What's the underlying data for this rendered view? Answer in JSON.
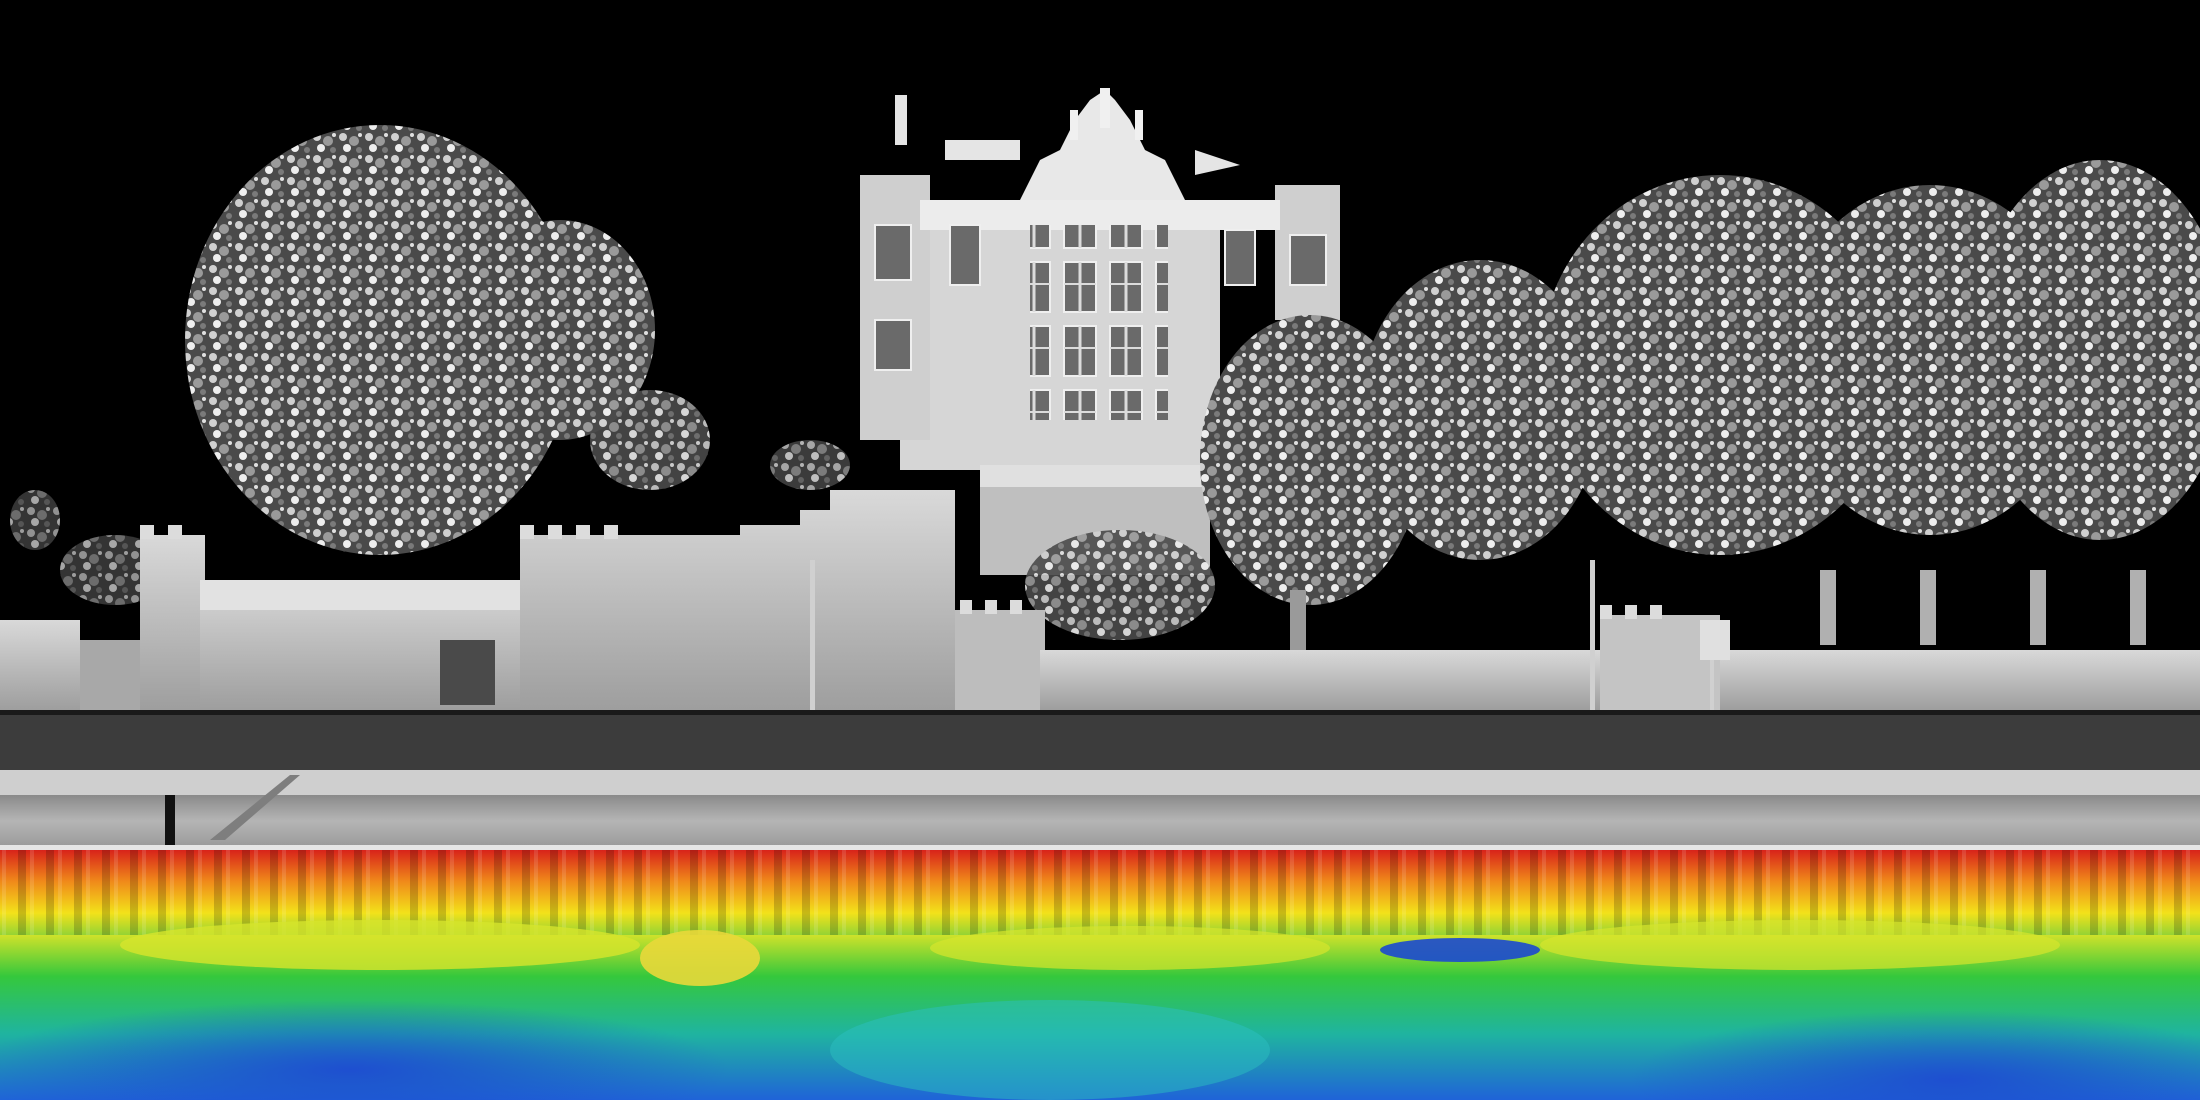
{
  "scene": {
    "subject": "lidar-point-cloud-riverside-castle",
    "colors": {
      "sky": "#000000",
      "structure": "#bdbdbd",
      "structure_light": "#e6e6e6",
      "structure_shadow": "#6f6f6f",
      "bathymetry_shallow": "#d8231a",
      "bathymetry_mid": "#f3e21a",
      "bathymetry_low": "#35c83c",
      "bathymetry_deep": "#1f63d8"
    }
  }
}
